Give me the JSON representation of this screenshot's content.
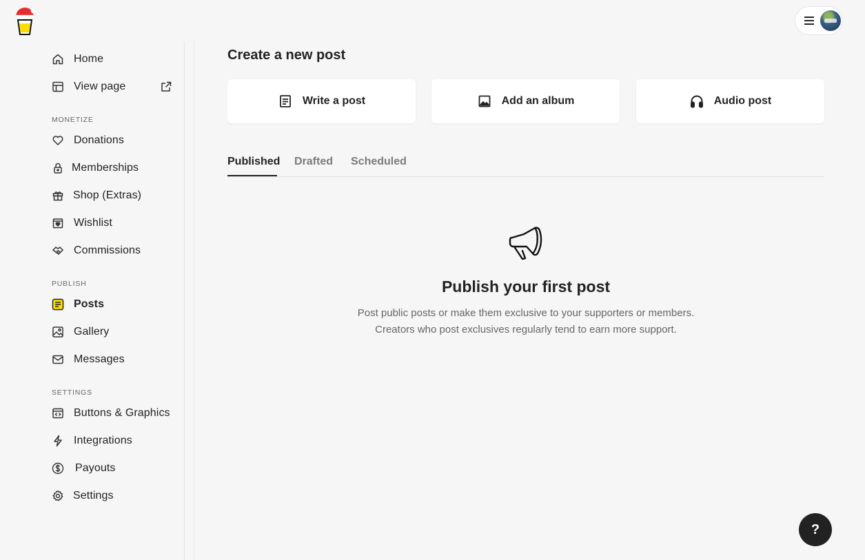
{
  "brand": {
    "logo": "coffee-cup-santa-hat-logo"
  },
  "topbar": {
    "menu_icon": "hamburger-icon",
    "avatar_icon": "user-avatar"
  },
  "sidebar": {
    "items": [
      {
        "label": "Home",
        "icon": "home-icon"
      },
      {
        "label": "View page",
        "icon": "layout-icon",
        "trailing_icon": "external-link-icon"
      }
    ],
    "sections": [
      {
        "label": "MONETIZE",
        "items": [
          {
            "label": "Donations",
            "icon": "heart-icon"
          },
          {
            "label": "Memberships",
            "icon": "lock-icon"
          },
          {
            "label": "Shop (Extras)",
            "icon": "gift-icon"
          },
          {
            "label": "Wishlist",
            "icon": "wishlist-icon"
          },
          {
            "label": "Commissions",
            "icon": "handshake-icon"
          }
        ]
      },
      {
        "label": "PUBLISH",
        "items": [
          {
            "label": "Posts",
            "icon": "posts-icon",
            "active": true
          },
          {
            "label": "Gallery",
            "icon": "image-icon"
          },
          {
            "label": "Messages",
            "icon": "mail-icon"
          }
        ]
      },
      {
        "label": "SETTINGS",
        "items": [
          {
            "label": "Buttons & Graphics",
            "icon": "code-window-icon"
          },
          {
            "label": "Integrations",
            "icon": "lightning-icon"
          },
          {
            "label": "Payouts",
            "icon": "dollar-icon"
          },
          {
            "label": "Settings",
            "icon": "gear-icon"
          }
        ]
      }
    ]
  },
  "main": {
    "title": "Create a new post",
    "cards": [
      {
        "label": "Write a post",
        "icon": "document-icon"
      },
      {
        "label": "Add an album",
        "icon": "image-icon"
      },
      {
        "label": "Audio post",
        "icon": "headphones-icon"
      }
    ],
    "tabs": [
      {
        "label": "Published",
        "active": true
      },
      {
        "label": "Drafted"
      },
      {
        "label": "Scheduled"
      }
    ],
    "empty_state": {
      "icon": "megaphone-icon",
      "title": "Publish your first post",
      "line1": "Post public posts or make them exclusive to your supporters or members.",
      "line2": "Creators who post exclusives regularly tend to earn more support."
    }
  },
  "help": {
    "label": "?"
  },
  "colors": {
    "accent_yellow": "#FFDD00",
    "dark": "#222222",
    "background": "#F6F6F6"
  }
}
